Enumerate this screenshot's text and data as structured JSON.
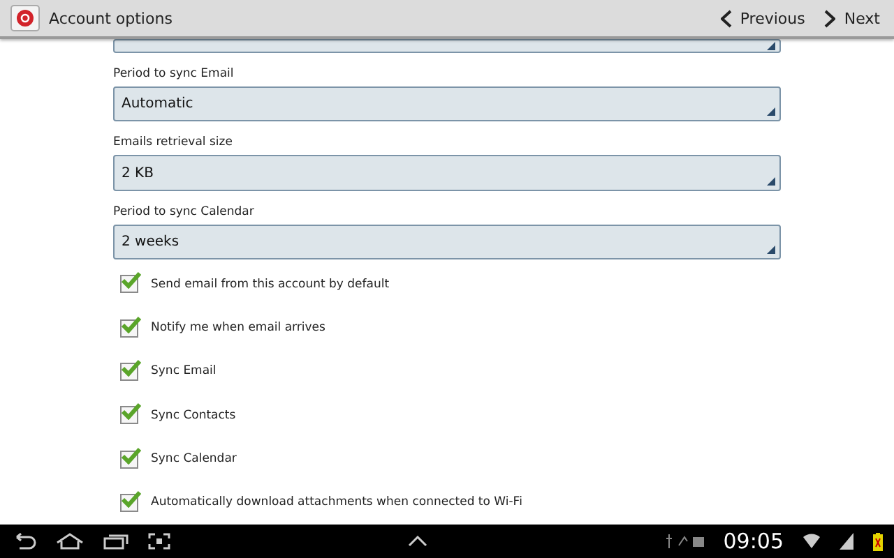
{
  "header": {
    "title": "Account options",
    "previous": "Previous",
    "next": "Next"
  },
  "dropdowns": [
    {
      "label": "Period to sync Email",
      "value": "Automatic"
    },
    {
      "label": "Emails retrieval size",
      "value": "2 KB"
    },
    {
      "label": "Period to sync Calendar",
      "value": "2 weeks"
    }
  ],
  "options": [
    {
      "label": "Send email from this account by default",
      "checked": true
    },
    {
      "label": "Notify me when email arrives",
      "checked": true
    },
    {
      "label": "Sync Email",
      "checked": true
    },
    {
      "label": "Sync Contacts",
      "checked": true
    },
    {
      "label": "Sync Calendar",
      "checked": true
    },
    {
      "label": "Automatically download attachments when connected to Wi-Fi",
      "checked": true
    }
  ],
  "status_bar": {
    "time": "09:05"
  }
}
